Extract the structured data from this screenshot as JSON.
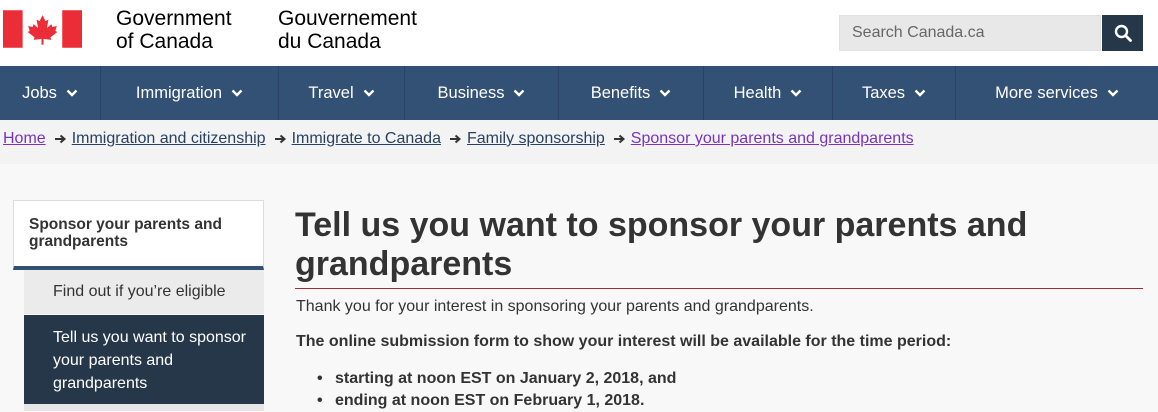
{
  "header": {
    "signature_en": [
      "Government",
      "of Canada"
    ],
    "signature_fr": [
      "Gouvernement",
      "du Canada"
    ],
    "search_placeholder": "Search Canada.ca",
    "colors": {
      "flag_red": "#eb2d37",
      "header_bg": "#ffffff"
    }
  },
  "nav": {
    "items": [
      {
        "label": "Jobs"
      },
      {
        "label": "Immigration"
      },
      {
        "label": "Travel"
      },
      {
        "label": "Business"
      },
      {
        "label": "Benefits"
      },
      {
        "label": "Health"
      },
      {
        "label": "Taxes"
      },
      {
        "label": "More services"
      }
    ],
    "colors": {
      "bg": "#335075"
    }
  },
  "breadcrumb": {
    "items": [
      {
        "label": "Home",
        "visited": true
      },
      {
        "label": "Immigration and citizenship",
        "visited": false
      },
      {
        "label": "Immigrate to Canada",
        "visited": false
      },
      {
        "label": "Family sponsorship",
        "visited": false
      },
      {
        "label": "Sponsor your parents and grandparents",
        "visited": true
      }
    ]
  },
  "sidebar": {
    "heading": "Sponsor your parents and grandparents",
    "items": [
      {
        "label": "Find out if you’re eligible",
        "active": false
      },
      {
        "label": "Tell us you want to sponsor your parents and grandparents",
        "active": true
      }
    ]
  },
  "main": {
    "title": "Tell us you want to sponsor your parents and grandparents",
    "intro": "Thank you for your interest in sponsoring your parents and grandparents.",
    "lead": "The online submission form to show your interest will be available for the time period:",
    "bullets": [
      "starting at noon EST on January 2, 2018, and",
      "ending at noon EST on February 1, 2018."
    ],
    "colors": {
      "title_rule": "#9b2d35"
    }
  }
}
